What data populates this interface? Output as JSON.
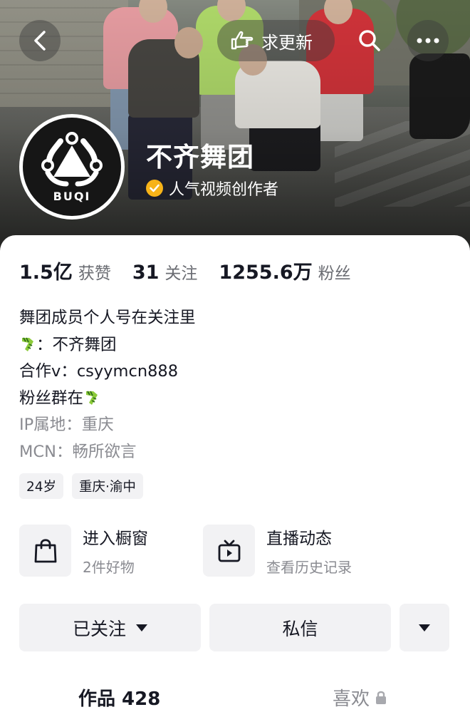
{
  "header": {
    "update_label": "求更新",
    "profile_name": "不齐舞团",
    "verification_text": "人气视频创作者",
    "avatar_logo_text": "BUQI"
  },
  "stats": [
    {
      "value": "1.5亿",
      "label": "获赞"
    },
    {
      "value": "31",
      "label": "关注"
    },
    {
      "value": "1255.6万",
      "label": "粉丝"
    }
  ],
  "bio": {
    "line1": "舞团成员个人号在关注里",
    "line2": "：不齐舞团",
    "line3": "合作v：csyymcn888",
    "line4": "粉丝群在",
    "ip_location": "IP属地：重庆",
    "mcn": "MCN：畅所欲言"
  },
  "tags": [
    "24岁",
    "重庆·渝中"
  ],
  "entries": {
    "shop": {
      "title": "进入橱窗",
      "subtitle": "2件好物",
      "icon": "shopping-bag-icon"
    },
    "live": {
      "title": "直播动态",
      "subtitle": "查看历史记录",
      "icon": "tv-icon"
    }
  },
  "actions": {
    "follow_label": "已关注",
    "message_label": "私信"
  },
  "tabs": {
    "works_label": "作品 428",
    "likes_label": "喜欢"
  },
  "colors": {
    "verify_badge": "#f7b318",
    "button_bg": "#f2f2f4",
    "muted_text": "#8a8b91"
  }
}
